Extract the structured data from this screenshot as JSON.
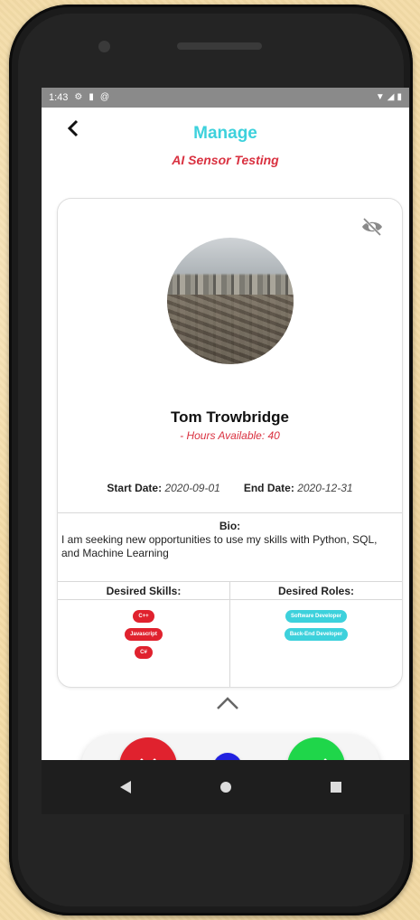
{
  "status_bar": {
    "time": "1:43",
    "icons": [
      "settings-icon",
      "sd-card-icon",
      "at-sign-icon",
      "wifi-icon",
      "signal-icon",
      "battery-icon"
    ]
  },
  "header": {
    "back_icon": "chevron-left-icon",
    "title": "Manage"
  },
  "project": {
    "title": "AI Sensor Testing"
  },
  "profile": {
    "visibility_icon": "eye-off-icon",
    "name": "Tom Trowbridge",
    "hours_available": "- Hours Available: 40",
    "start_date_label": "Start Date:",
    "start_date": "2020-09-01",
    "end_date_label": "End Date:",
    "end_date": "2020-12-31",
    "bio_label": "Bio:",
    "bio": "I am seeking new opportunities to use my skills with Python, SQL, and Machine Learning",
    "skills_label": "Desired Skills:",
    "skills": [
      "C++",
      "Javascript",
      "C#"
    ],
    "roles_label": "Desired Roles:",
    "roles": [
      "Software Developer",
      "Back-End Developer"
    ]
  },
  "actions": {
    "expand_icon": "chevron-up-icon",
    "reject_icon": "close-icon",
    "refresh_icon": "refresh-icon",
    "accept_icon": "check-icon"
  },
  "colors": {
    "accent": "#3dd1dc",
    "highlight_red": "#d93140",
    "reject": "#e0222e",
    "refresh": "#2222e0",
    "accept": "#1fd64a"
  }
}
